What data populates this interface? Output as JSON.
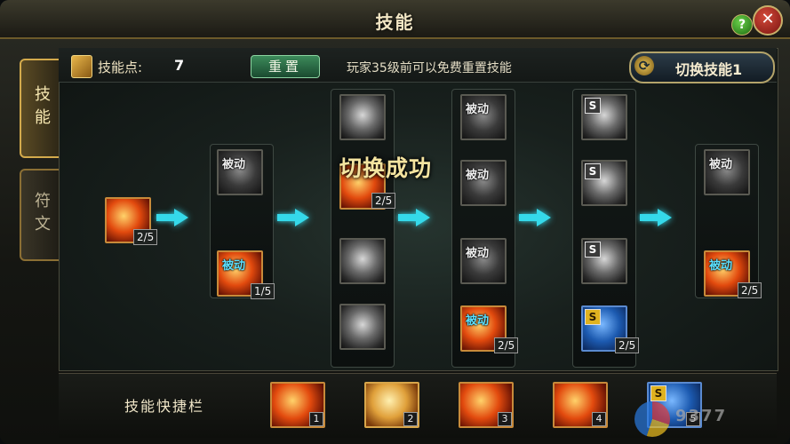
{
  "window": {
    "title": "技能",
    "help_label": "?",
    "close_label": "✕"
  },
  "side_tabs": [
    {
      "label": "技能",
      "active": true
    },
    {
      "label": "符文",
      "active": false
    }
  ],
  "header": {
    "points_label": "技能点:",
    "points_value": "7",
    "reset_label": "重置",
    "reset_note": "玩家35级前可以免费重置技能",
    "switch_label": "切换技能1"
  },
  "toast": "切换成功",
  "tree": {
    "col1": [
      {
        "icon": "fire-slash-icon",
        "level": "2/5"
      }
    ],
    "col2": [
      {
        "icon": "passive-blade-icon",
        "tag": "被动"
      },
      {
        "icon": "fire-passive-icon",
        "tag": "被动",
        "level": "1/5"
      }
    ],
    "col3": [
      {
        "icon": "warrior-strike-icon"
      },
      {
        "icon": "fire-blades-icon",
        "level": "2/5"
      },
      {
        "icon": "shield-bash-icon"
      },
      {
        "icon": "spear-thrust-icon"
      }
    ],
    "col4": [
      {
        "icon": "helmet-passive-icon",
        "tag": "被动"
      },
      {
        "icon": "sword-passive-icon",
        "tag": "被动"
      },
      {
        "icon": "group-passive-icon",
        "tag": "被动"
      },
      {
        "icon": "fire-passive-icon-2",
        "tag": "被动",
        "level": "2/5"
      }
    ],
    "col5": [
      {
        "icon": "s-slash-icon",
        "tag": "S"
      },
      {
        "icon": "s-dash-icon",
        "tag": "S"
      },
      {
        "icon": "s-whirl-icon",
        "tag": "S"
      },
      {
        "icon": "s-blue-strike-icon",
        "tag": "S",
        "level": "2/5"
      }
    ],
    "col6": [
      {
        "icon": "passive-wings-icon",
        "tag": "被动"
      },
      {
        "icon": "fire-passive-icon-3",
        "tag": "被动",
        "level": "2/5"
      }
    ]
  },
  "quickbar": {
    "label": "技能快捷栏",
    "slots": [
      {
        "icon": "fire-slash-icon",
        "num": "1"
      },
      {
        "icon": "spear-thrust-icon",
        "num": "2"
      },
      {
        "icon": "fire-warrior-icon",
        "num": "3"
      },
      {
        "icon": "fire-blades-icon",
        "num": "4"
      },
      {
        "icon": "s-blue-strike-icon",
        "num": "5",
        "tag": "S"
      }
    ]
  },
  "watermark": "9377"
}
